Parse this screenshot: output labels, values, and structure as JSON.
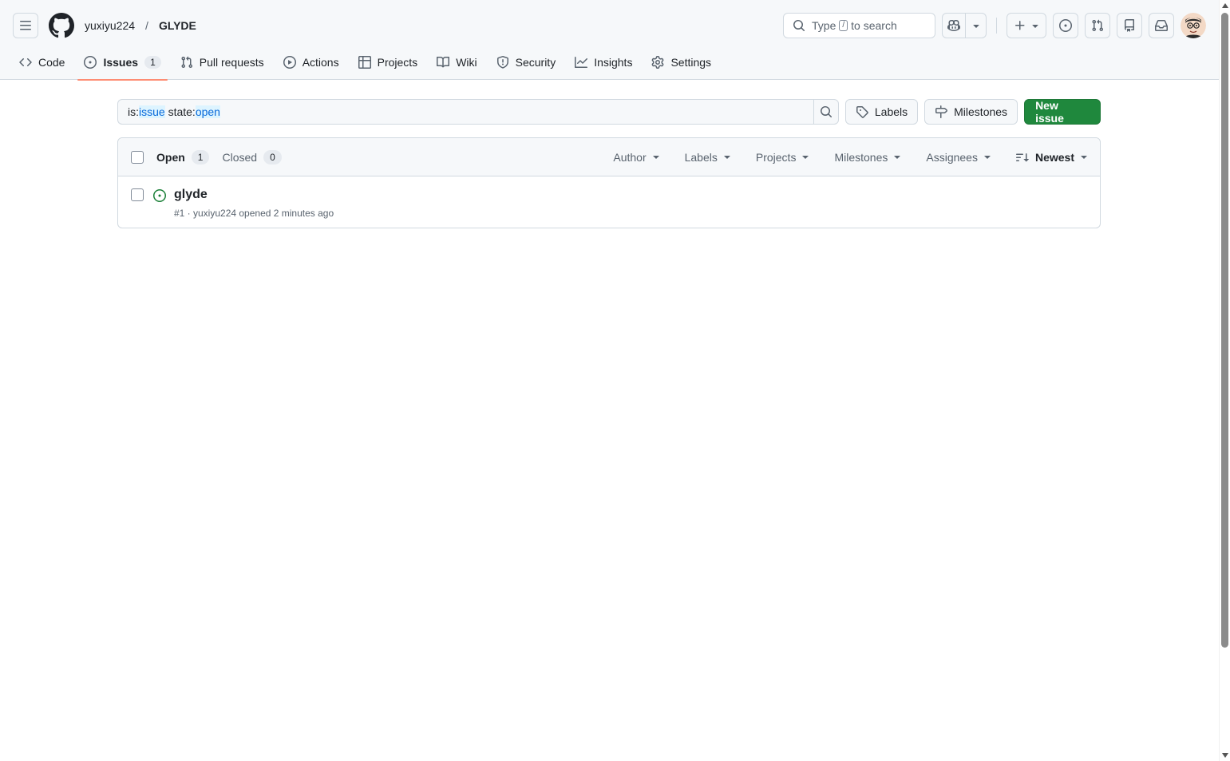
{
  "header": {
    "owner": "yuxiyu224",
    "separator": "/",
    "repo": "GLYDE",
    "search": {
      "prefix": "Type",
      "key": "/",
      "suffix": "to search"
    }
  },
  "tabs": [
    {
      "label": "Code",
      "icon": "code-icon"
    },
    {
      "label": "Issues",
      "icon": "issue-opened-icon",
      "count": "1",
      "active": true
    },
    {
      "label": "Pull requests",
      "icon": "git-pull-request-icon"
    },
    {
      "label": "Actions",
      "icon": "play-icon"
    },
    {
      "label": "Projects",
      "icon": "table-icon"
    },
    {
      "label": "Wiki",
      "icon": "book-icon"
    },
    {
      "label": "Security",
      "icon": "shield-icon"
    },
    {
      "label": "Insights",
      "icon": "graph-icon"
    },
    {
      "label": "Settings",
      "icon": "gear-icon"
    }
  ],
  "filterbar": {
    "query": {
      "k1": "is:",
      "v1": "issue",
      "k2": " state:",
      "v2": "open"
    },
    "labels_button": "Labels",
    "milestones_button": "Milestones",
    "new_issue_button": "New issue"
  },
  "list": {
    "open_label": "Open",
    "open_count": "1",
    "closed_label": "Closed",
    "closed_count": "0",
    "filters": [
      "Author",
      "Labels",
      "Projects",
      "Milestones",
      "Assignees"
    ],
    "sort_label": "Newest",
    "issues": [
      {
        "title": "glyde",
        "meta": "#1 · yuxiyu224 opened 2 minutes ago"
      }
    ]
  },
  "colors": {
    "accent_green": "#1f883d",
    "tab_underline": "#fd8c73",
    "open_icon": "#1a7f37"
  }
}
